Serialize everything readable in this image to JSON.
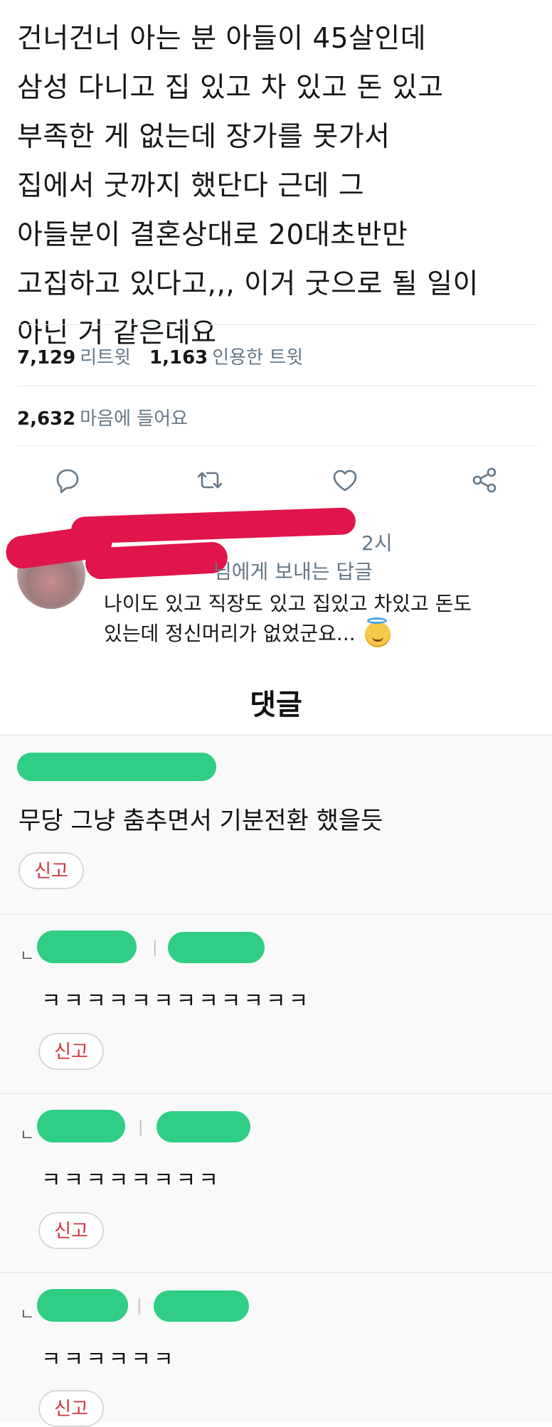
{
  "tweet": {
    "lines": [
      "건너건너 아는 분 아들이 45살인데",
      "삼성 다니고 집 있고 차 있고 돈 있고",
      "부족한 게 없는데 장가를 못가서",
      "집에서 굿까지 했단다 근데 그",
      "아들분이 결혼상대로 20대초반만",
      "고집하고 있다고,,, 이거 굿으로 될 일이",
      "아닌 거 같은데요"
    ],
    "retweets_count": "7,129",
    "retweets_label": "리트윗",
    "quotes_count": "1,163",
    "quotes_label": "인용한 트윗",
    "likes_count": "2,632",
    "likes_label": "마음에 들어요",
    "actions": [
      "reply-icon",
      "retweet-icon",
      "heart-icon",
      "share-icon"
    ]
  },
  "reply": {
    "time": "2시",
    "replying_to": "님에게 보내는 답글",
    "lines": [
      "나이도 있고 직장도 있고 집있고 차있고 돈도",
      "있는데 정신머리가 없었군요..."
    ],
    "emoji": "smiling-face-with-halo"
  },
  "comments_section": {
    "header": "댓글",
    "top_comment": {
      "text": "무당 그냥 춤추면서 기분전환 했을듯",
      "report_label": "신고"
    },
    "replies": [
      {
        "mark": "ㄴ",
        "text": "ㅋㅋㅋㅋㅋㅋㅋㅋㅋㅋㅋㅋ",
        "report_label": "신고"
      },
      {
        "mark": "ㄴ",
        "text": "ㅋㅋㅋㅋㅋㅋㅋㅋ",
        "report_label": "신고"
      },
      {
        "mark": "ㄴ",
        "text": "ㅋㅋㅋㅋㅋㅋ",
        "report_label": "신고"
      }
    ]
  },
  "colors": {
    "redaction_red": "#e0154a",
    "redaction_green": "#2fce84",
    "report_red": "#d0313a",
    "muted_text": "#657786"
  }
}
